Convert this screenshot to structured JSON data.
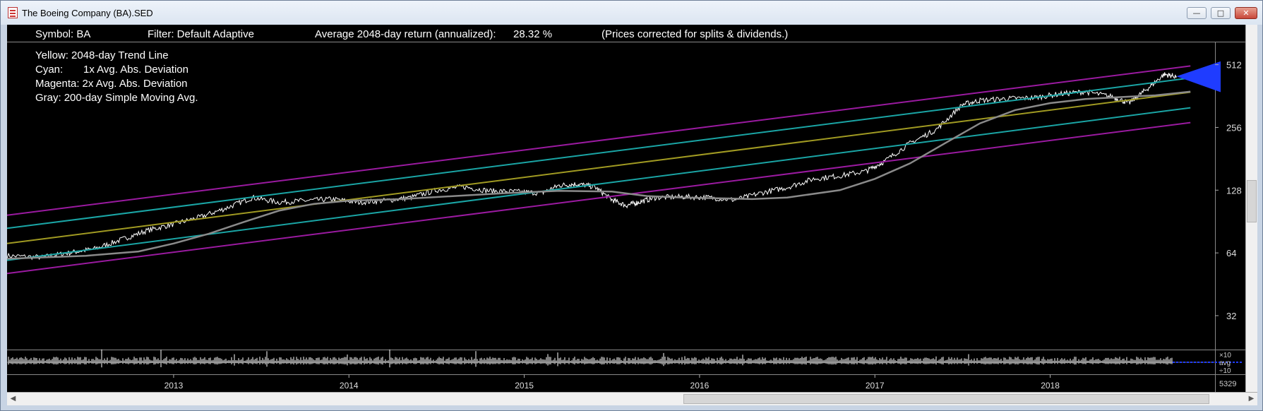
{
  "window": {
    "title": "The Boeing Company (BA).SED",
    "minimize_glyph": "—",
    "maximize_glyph": "□",
    "close_glyph": "✕"
  },
  "header": {
    "symbol": "Symbol: BA",
    "filter": "Filter: Default Adaptive",
    "avg_return_label": "Average 2048-day return (annualized):",
    "avg_return_value": "28.32 %",
    "note": "(Prices corrected for splits & dividends.)"
  },
  "legend": {
    "lines": [
      {
        "key": "Yellow:",
        "text": "2048-day Trend Line",
        "color": "#a09a22"
      },
      {
        "key": "Cyan:",
        "text": "1x Avg. Abs. Deviation",
        "color": "#1aa5a5"
      },
      {
        "key": "Magenta:",
        "text": "2x Avg. Abs. Deviation",
        "color": "#9a1aa0"
      },
      {
        "key": "Gray:",
        "text": "200-day Simple Moving Avg.",
        "color": "#8a8a8a"
      }
    ]
  },
  "chart_data": {
    "type": "line",
    "log_scale": true,
    "ylim": [
      22,
      650
    ],
    "xlim": [
      2012.05,
      2018.94
    ],
    "y_ticks": [
      32,
      64,
      128,
      256,
      512
    ],
    "y_tick_labels": [
      "32",
      "64",
      "128",
      "256",
      "512"
    ],
    "x_tick_labels": [
      "2013",
      "2014",
      "2015",
      "2016",
      "2017",
      "2018"
    ],
    "x_ticks": [
      2013,
      2014,
      2015,
      2016,
      2017,
      2018
    ],
    "series": [
      {
        "name": "Price",
        "color": "#ffffff",
        "x": [
          2012.05,
          2012.25,
          2012.4,
          2012.55,
          2012.7,
          2012.85,
          2013.0,
          2013.15,
          2013.3,
          2013.45,
          2013.6,
          2013.75,
          2013.9,
          2014.05,
          2014.2,
          2014.35,
          2014.5,
          2014.65,
          2014.8,
          2014.95,
          2015.1,
          2015.2,
          2015.3,
          2015.4,
          2015.5,
          2015.58,
          2015.65,
          2015.75,
          2015.9,
          2016.05,
          2016.2,
          2016.35,
          2016.5,
          2016.65,
          2016.8,
          2016.95,
          2017.05,
          2017.2,
          2017.35,
          2017.5,
          2017.6,
          2017.75,
          2017.9,
          2018.05,
          2018.2,
          2018.35,
          2018.45,
          2018.55,
          2018.65,
          2018.72
        ],
        "values": [
          62,
          61,
          64,
          67,
          74,
          82,
          88,
          95,
          105,
          118,
          112,
          114,
          116,
          112,
          114,
          118,
          128,
          133,
          127,
          126,
          124,
          135,
          137,
          133,
          115,
          108,
          112,
          118,
          119,
          118,
          115,
          124,
          132,
          145,
          150,
          158,
          175,
          215,
          250,
          330,
          345,
          352,
          355,
          370,
          380,
          360,
          335,
          390,
          460,
          450
        ]
      },
      {
        "name": "2048-day Trend Line",
        "color": "#a09a22",
        "x": [
          2012.05,
          2018.8
        ],
        "values": [
          71,
          378
        ]
      },
      {
        "name": "1x Avg. Abs. Deviation (upper)",
        "color": "#1aa5a5",
        "x": [
          2012.05,
          2018.8
        ],
        "values": [
          84,
          442
        ]
      },
      {
        "name": "1x Avg. Abs. Deviation (lower)",
        "color": "#1aa5a5",
        "x": [
          2012.05,
          2018.8
        ],
        "values": [
          59,
          318
        ]
      },
      {
        "name": "2x Avg. Abs. Deviation (upper)",
        "color": "#9a1aa0",
        "x": [
          2012.05,
          2018.8
        ],
        "values": [
          97,
          505
        ]
      },
      {
        "name": "2x Avg. Abs. Deviation (lower)",
        "color": "#9a1aa0",
        "x": [
          2012.05,
          2018.8
        ],
        "values": [
          51,
          270
        ]
      },
      {
        "name": "200-day Simple Moving Avg.",
        "color": "#8a8a8a",
        "x": [
          2012.05,
          2012.5,
          2012.8,
          2013.0,
          2013.2,
          2013.4,
          2013.6,
          2013.8,
          2014.0,
          2014.3,
          2014.6,
          2014.9,
          2015.2,
          2015.5,
          2015.7,
          2015.9,
          2016.1,
          2016.3,
          2016.5,
          2016.8,
          2017.0,
          2017.2,
          2017.4,
          2017.6,
          2017.8,
          2018.0,
          2018.2,
          2018.4,
          2018.6,
          2018.8
        ],
        "values": [
          60,
          62,
          65,
          71,
          79,
          90,
          102,
          110,
          114,
          116,
          120,
          124,
          127,
          126,
          120,
          118,
          117,
          116,
          118,
          128,
          145,
          172,
          215,
          268,
          310,
          335,
          350,
          358,
          365,
          380
        ]
      }
    ]
  },
  "volume_panel": {
    "labels": [
      "×10",
      "avg",
      "÷10"
    ],
    "count": "5329"
  }
}
